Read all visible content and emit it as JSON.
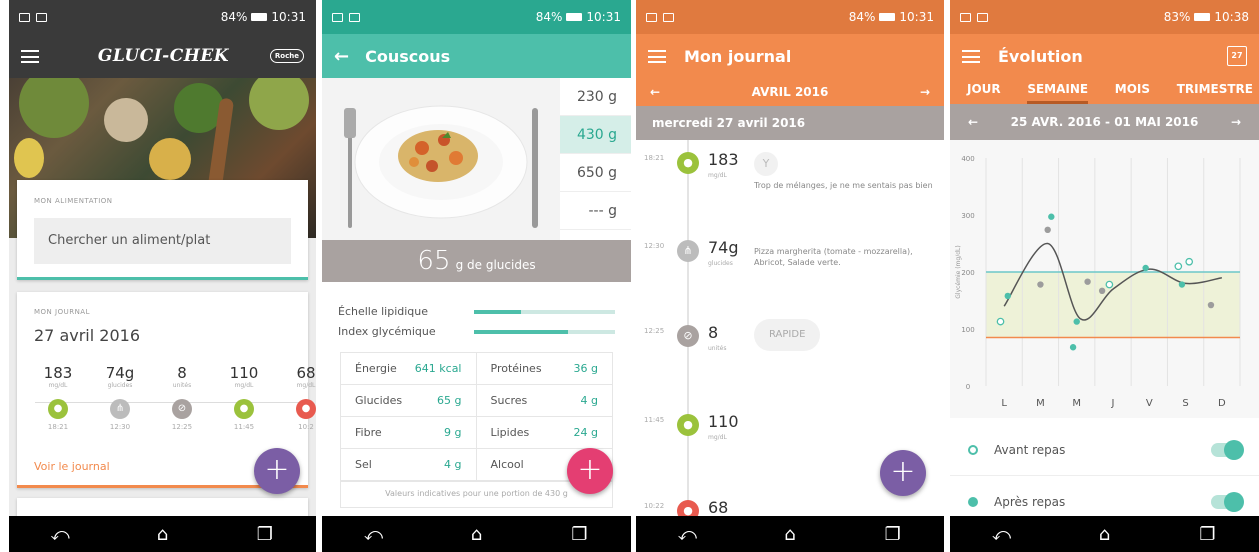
{
  "colors": {
    "teal": "#4dbfaa",
    "orange": "#f28a4d",
    "purple": "#7b5ea5",
    "pink": "#e43e72",
    "green": "#9bc23c",
    "grey": "#a9a2a0",
    "red": "#e85a4f"
  },
  "phone1": {
    "status": {
      "battery": "84%",
      "time": "10:31"
    },
    "app_title": "Gluci-Chek",
    "brand_badge": "Roche",
    "alimentation": {
      "label": "MON ALIMENTATION",
      "search_placeholder": "Chercher un aliment/plat"
    },
    "journal": {
      "label": "MON JOURNAL",
      "date": "27 avril 2016",
      "entries": [
        {
          "value": "183",
          "unit": "mg/dL",
          "time": "18:21",
          "type": "glycemia",
          "icon": "drop-icon",
          "color": "#9bc23c"
        },
        {
          "value": "74g",
          "unit": "glucides",
          "time": "12:30",
          "type": "meal",
          "icon": "cutlery-icon",
          "color": "#bcbcbc"
        },
        {
          "value": "8",
          "unit": "unités",
          "time": "12:25",
          "type": "insulin",
          "icon": "syringe-icon",
          "color": "#a9a2a0"
        },
        {
          "value": "110",
          "unit": "mg/dL",
          "time": "11:45",
          "type": "glycemia",
          "icon": "drop-icon",
          "color": "#9bc23c"
        },
        {
          "value": "68",
          "unit": "mg/dL",
          "time": "10:2",
          "type": "glycemia",
          "icon": "drop-icon",
          "color": "#e85a4f"
        }
      ],
      "link": "Voir le journal"
    }
  },
  "phone2": {
    "status": {
      "battery": "84%",
      "time": "10:31"
    },
    "title": "Couscous",
    "portions": [
      "230 g",
      "430 g",
      "650 g",
      "--- g"
    ],
    "selected_portion": "430 g",
    "glucides": {
      "value": "65",
      "label": "g de glucides"
    },
    "scales": [
      {
        "label": "Échelle lipidique",
        "level": 0.33
      },
      {
        "label": "Index glycémique",
        "level": 0.67
      }
    ],
    "nutrition": [
      [
        {
          "name": "Énergie",
          "value": "641 kcal"
        },
        {
          "name": "Protéines",
          "value": "36 g"
        }
      ],
      [
        {
          "name": "Glucides",
          "value": "65 g"
        },
        {
          "name": "Sucres",
          "value": "4 g"
        }
      ],
      [
        {
          "name": "Fibre",
          "value": "9 g"
        },
        {
          "name": "Lipides",
          "value": "24 g"
        }
      ],
      [
        {
          "name": "Sel",
          "value": "4 g"
        },
        {
          "name": "Alcool",
          "value": ""
        }
      ]
    ],
    "footnote": "Valeurs indicatives pour une portion de 430 g"
  },
  "phone3": {
    "status": {
      "battery": "84%",
      "time": "10:31"
    },
    "title": "Mon journal",
    "month": "AVRIL 2016",
    "day": "mercredi 27 avril 2016",
    "entries": [
      {
        "time": "18:21",
        "value": "183",
        "unit": "mg/dL",
        "icon": "drop-icon",
        "color": "#9bc23c",
        "note": "Trop de mélanges, je ne me sentais pas bien"
      },
      {
        "time": "12:30",
        "value": "74g",
        "unit": "glucides",
        "icon": "cutlery-icon",
        "color": "#bcbcbc",
        "note": "Pizza margherita (tomate - mozzarella), Abricot, Salade verte."
      },
      {
        "time": "12:25",
        "value": "8",
        "unit": "unités",
        "icon": "syringe-icon",
        "color": "#a9a2a0",
        "tag": "RAPIDE"
      },
      {
        "time": "11:45",
        "value": "110",
        "unit": "mg/dL",
        "icon": "drop-icon",
        "color": "#9bc23c"
      },
      {
        "time": "10:22",
        "value": "68",
        "unit": "",
        "icon": "drop-icon",
        "color": "#e85a4f"
      }
    ]
  },
  "phone4": {
    "status": {
      "battery": "83%",
      "time": "10:38"
    },
    "title": "Évolution",
    "calendar_badge": "27",
    "tabs": [
      "JOUR",
      "SEMAINE",
      "MOIS",
      "TRIMESTRE"
    ],
    "active_tab": "SEMAINE",
    "week": "25 AVR. 2016 - 01 MAI 2016",
    "chart_data": {
      "type": "scatter",
      "categories": [
        "L",
        "M",
        "M",
        "J",
        "V",
        "S",
        "D"
      ],
      "ylabel": "Glycémie (mg/dL)",
      "yticks": [
        0,
        100,
        200,
        300,
        400
      ],
      "ylim": [
        0,
        400
      ],
      "target_range": [
        85,
        200
      ],
      "series": [
        {
          "name": "Avant repas",
          "style": "hollow-teal",
          "points": [
            [
              0.9,
              113
            ],
            [
              3.9,
              178
            ],
            [
              5.8,
              210
            ],
            [
              6.1,
              218
            ]
          ]
        },
        {
          "name": "Après repas",
          "style": "teal",
          "points": [
            [
              1.1,
              158
            ],
            [
              2.3,
              297
            ],
            [
              2.9,
              68
            ],
            [
              3.0,
              113
            ],
            [
              4.9,
              207
            ],
            [
              5.9,
              178
            ]
          ]
        },
        {
          "name": "",
          "style": "grey",
          "points": [
            [
              2.0,
              178
            ],
            [
              2.2,
              274
            ],
            [
              3.3,
              183
            ],
            [
              3.7,
              167
            ],
            [
              6.7,
              142
            ]
          ]
        }
      ],
      "trend": [
        [
          1.0,
          140
        ],
        [
          2.2,
          250
        ],
        [
          3.1,
          118
        ],
        [
          4.0,
          170
        ],
        [
          5.0,
          205
        ],
        [
          6.0,
          180
        ],
        [
          7.0,
          190
        ]
      ]
    },
    "legend": [
      {
        "label": "Avant repas",
        "marker": "hollow",
        "enabled": true
      },
      {
        "label": "Après repas",
        "marker": "filled",
        "enabled": true
      }
    ]
  }
}
